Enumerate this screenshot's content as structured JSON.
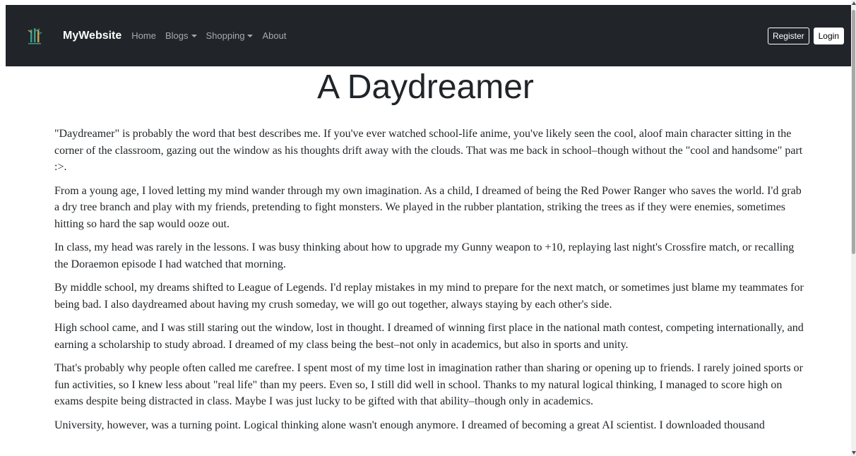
{
  "navbar": {
    "brand": "MyWebsite",
    "items": [
      {
        "label": "Home",
        "dropdown": false
      },
      {
        "label": "Blogs",
        "dropdown": true
      },
      {
        "label": "Shopping",
        "dropdown": true
      },
      {
        "label": "About",
        "dropdown": false
      }
    ],
    "register_label": "Register",
    "login_label": "Login",
    "logo_icon": "bamboo-logo-icon",
    "bg_color": "#212529"
  },
  "article": {
    "title": "A Daydreamer",
    "paragraphs": [
      "\"Daydreamer\" is probably the word that best describes me. If you've ever watched school-life anime, you've likely seen the cool, aloof main character sitting in the corner of the classroom, gazing out the window as his thoughts drift away with the clouds. That was me back in school–though without the \"cool and handsome\" part :>.",
      "From a young age, I loved letting my mind wander through my own imagination. As a child, I dreamed of being the Red Power Ranger who saves the world. I'd grab a dry tree branch and play with my friends, pretending to fight monsters. We played in the rubber plantation, striking the trees as if they were enemies, sometimes hitting so hard the sap would ooze out.",
      "In class, my head was rarely in the lessons. I was busy thinking about how to upgrade my Gunny weapon to +10, replaying last night's Crossfire match, or recalling the Doraemon episode I had watched that morning.",
      "By middle school, my dreams shifted to League of Legends. I'd replay mistakes in my mind to prepare for the next match, or sometimes just blame my teammates for being bad. I also daydreamed about having my crush someday, we will go out together, always staying by each other's side.",
      "High school came, and I was still staring out the window, lost in thought. I dreamed of winning first place in the national math contest, competing internationally, and earning a scholarship to study abroad. I dreamed of my class being the best–not only in academics, but also in sports and unity.",
      "That's probably why people often called me carefree. I spent most of my time lost in imagination rather than sharing or opening up to friends. I rarely joined sports or fun activities, so I knew less about \"real life\" than my peers. Even so, I still did well in school. Thanks to my natural logical thinking, I managed to score high on exams despite being distracted in class. Maybe I was just lucky to be gifted with that ability–though only in academics.",
      "University, however, was a turning point. Logical thinking alone wasn't enough anymore. I dreamed of becoming a great AI scientist. I downloaded thousand"
    ]
  }
}
